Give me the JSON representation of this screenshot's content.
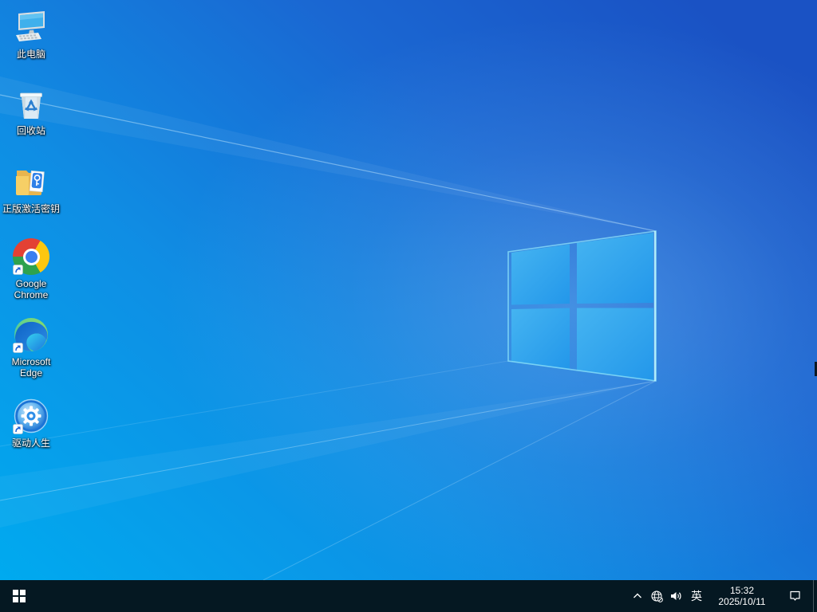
{
  "desktop": {
    "icons": [
      {
        "name": "this-pc",
        "label": "此电脑"
      },
      {
        "name": "recycle-bin",
        "label": "回收站"
      },
      {
        "name": "activation-key-folder",
        "label": "正版激活密钥"
      },
      {
        "name": "google-chrome",
        "label": "Google Chrome"
      },
      {
        "name": "microsoft-edge",
        "label": "Microsoft Edge"
      },
      {
        "name": "driver-life",
        "label": "驱动人生"
      }
    ]
  },
  "taskbar": {
    "tray": {
      "ime_indicator": "英",
      "time": "15:32",
      "date": "2025/10/11"
    }
  },
  "colors": {
    "taskbar_bg": "#051822",
    "wallpaper_bottom_left": "#00aaef",
    "wallpaper_top_left": "#1b97e3",
    "wallpaper_right": "#1a52c4",
    "logo_pane": "#2fa5ee",
    "logo_edge_glow": "#9feafc"
  }
}
